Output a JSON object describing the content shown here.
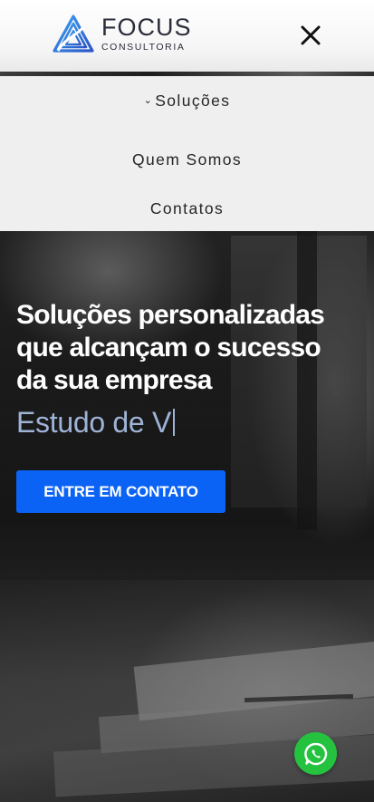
{
  "header": {
    "logo_title": "FOCUS",
    "logo_subtitle": "CONSULTORIA",
    "close_icon": "close-icon",
    "brand_color": "#2b6fd6"
  },
  "menu": {
    "items": [
      {
        "label": "Soluções",
        "has_dropdown": true,
        "icon": "chevron-down-icon"
      },
      {
        "label": "Quem Somos"
      },
      {
        "label": "Contatos"
      }
    ]
  },
  "hero": {
    "headline": "Soluções personalizadas que alcançam o sucesso da sua empresa",
    "typed_text": "Estudo de V",
    "typed_color": "#9fb3d6",
    "cta_label": "ENTRE EM CONTATO",
    "cta_color": "#0b63f6"
  },
  "floating": {
    "whatsapp_icon": "whatsapp-icon",
    "whatsapp_color": "#25c240"
  }
}
